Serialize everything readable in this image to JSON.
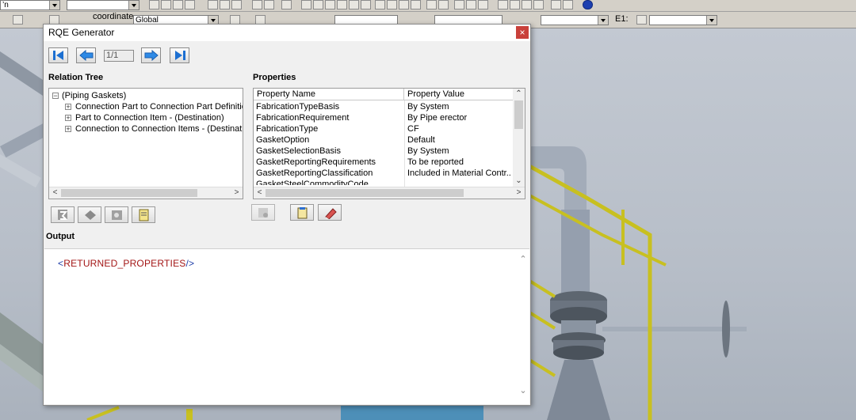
{
  "toolbar": {
    "left_combo_value": "’n",
    "coordinate_label": "coordinate",
    "coordinate_value": "Global",
    "e1_label": "E1:"
  },
  "dialog": {
    "title": "RQE Generator",
    "close_label": "×",
    "navigation": {
      "page": "1/1",
      "first_label": "First",
      "previous_label": "Previous",
      "next_label": "Next",
      "last_label": "Last"
    },
    "relation_tree": {
      "label": "Relation Tree",
      "root": {
        "expander": "−",
        "label": "(Piping Gaskets)"
      },
      "children": [
        {
          "expander": "+",
          "label": "Connection Part to Connection Part Definitio"
        },
        {
          "expander": "+",
          "label": "Part to Connection Item - (Destination)"
        },
        {
          "expander": "+",
          "label": "Connection to Connection Items - (Destinati"
        }
      ]
    },
    "properties": {
      "label": "Properties",
      "columns": [
        "Property Name",
        "Property Value"
      ],
      "rows": [
        {
          "name": "FabricationTypeBasis",
          "value": "By System"
        },
        {
          "name": "FabricationRequirement",
          "value": "By Pipe erector"
        },
        {
          "name": "FabricationType",
          "value": "CF"
        },
        {
          "name": "GasketOption",
          "value": "Default"
        },
        {
          "name": "GasketSelectionBasis",
          "value": "By System"
        },
        {
          "name": "GasketReportingRequirements",
          "value": "To be reported"
        },
        {
          "name": "GasketReportingClassification",
          "value": "Included in Material Contr..."
        },
        {
          "name": "GasketSteelCommodityCode",
          "value": ""
        }
      ]
    },
    "output": {
      "label": "Output",
      "open": "<",
      "tag": "RETURNED_PROPERTIES",
      "close": "/>"
    }
  },
  "colors": {
    "accent_blue": "#1c6fd1",
    "close_red": "#c9403a",
    "railing_yellow": "#c8c020",
    "pipe_grey": "#9aa3b0",
    "output_tag_red": "#a31515",
    "output_bracket_blue": "#1f3ea8"
  },
  "icons": [
    "first-page-icon",
    "previous-page-icon",
    "next-page-icon",
    "last-page-icon",
    "close-icon",
    "add-relation-icon",
    "delete-relation-icon",
    "filter-icon",
    "copy-icon",
    "properties-icon",
    "select-property-icon",
    "clear-icon",
    "chevron-down-icon"
  ]
}
